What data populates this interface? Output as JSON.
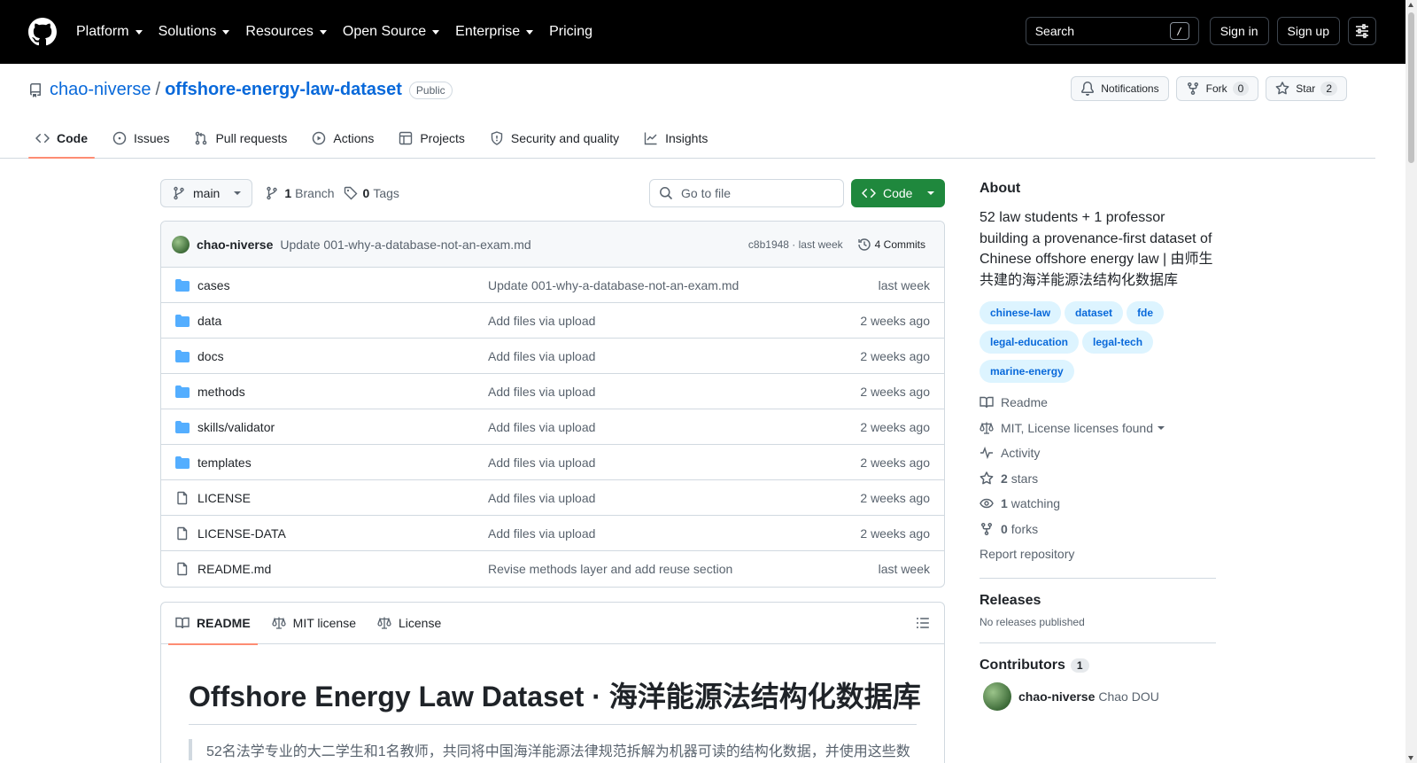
{
  "header": {
    "nav": [
      "Platform",
      "Solutions",
      "Resources",
      "Open Source",
      "Enterprise",
      "Pricing"
    ],
    "search_label": "Search",
    "search_kbd": "/",
    "sign_in": "Sign in",
    "sign_up": "Sign up"
  },
  "repo": {
    "owner": "chao-niverse",
    "separator": "/",
    "name": "offshore-energy-law-dataset",
    "visibility": "Public",
    "notifications_label": "Notifications",
    "fork_label": "Fork",
    "fork_count": "0",
    "star_label": "Star",
    "star_count": "2"
  },
  "tabs": [
    "Code",
    "Issues",
    "Pull requests",
    "Actions",
    "Projects",
    "Security and quality",
    "Insights"
  ],
  "toolbar": {
    "branch": "main",
    "branch_count": "1",
    "branch_label": "Branch",
    "tag_count": "0",
    "tag_label": "Tags",
    "goto_placeholder": "Go to file",
    "code_label": "Code"
  },
  "latest_commit": {
    "author": "chao-niverse",
    "message": "Update 001-why-a-database-not-an-exam.md",
    "sha_time": "c8b1948 · last week",
    "commits": "4 Commits"
  },
  "files": [
    {
      "type": "dir",
      "name": "cases",
      "message": "Update 001-why-a-database-not-an-exam.md",
      "date": "last week"
    },
    {
      "type": "dir",
      "name": "data",
      "message": "Add files via upload",
      "date": "2 weeks ago"
    },
    {
      "type": "dir",
      "name": "docs",
      "message": "Add files via upload",
      "date": "2 weeks ago"
    },
    {
      "type": "dir",
      "name": "methods",
      "message": "Add files via upload",
      "date": "2 weeks ago"
    },
    {
      "type": "dir",
      "name": "skills/validator",
      "message": "Add files via upload",
      "date": "2 weeks ago"
    },
    {
      "type": "dir",
      "name": "templates",
      "message": "Add files via upload",
      "date": "2 weeks ago"
    },
    {
      "type": "file",
      "name": "LICENSE",
      "message": "Add files via upload",
      "date": "2 weeks ago"
    },
    {
      "type": "file",
      "name": "LICENSE-DATA",
      "message": "Add files via upload",
      "date": "2 weeks ago"
    },
    {
      "type": "file",
      "name": "README.md",
      "message": "Revise methods layer and add reuse section",
      "date": "last week"
    }
  ],
  "readme": {
    "tabs": [
      "README",
      "MIT license",
      "License"
    ],
    "title": "Offshore Energy Law Dataset · 海洋能源法结构化数据库",
    "quote": "52名法学专业的大二学生和1名教师，共同将中国海洋能源法律规范拆解为机器可读的结构化数据，并使用这些数"
  },
  "about": {
    "heading": "About",
    "description": "52 law students + 1 professor building a provenance-first dataset of Chinese offshore energy law | 由师生共建的海洋能源法结构化数据库",
    "topics": [
      "chinese-law",
      "dataset",
      "fde",
      "legal-education",
      "legal-tech",
      "marine-energy"
    ],
    "readme": "Readme",
    "license": "MIT, License licenses found",
    "activity": "Activity",
    "stars_count": "2",
    "stars_label": "stars",
    "watching_count": "1",
    "watching_label": "watching",
    "forks_count": "0",
    "forks_label": "forks",
    "report": "Report repository"
  },
  "releases": {
    "heading": "Releases",
    "empty": "No releases published"
  },
  "contributors": {
    "heading": "Contributors",
    "count": "1",
    "list": [
      {
        "login": "chao-niverse",
        "name": "Chao DOU"
      }
    ]
  },
  "colors": {
    "link": "#0969da",
    "primary_button": "#1f883d",
    "tab_underline": "#fd8c73",
    "folder": "#54aeff",
    "topic_bg": "#ddf4ff"
  }
}
